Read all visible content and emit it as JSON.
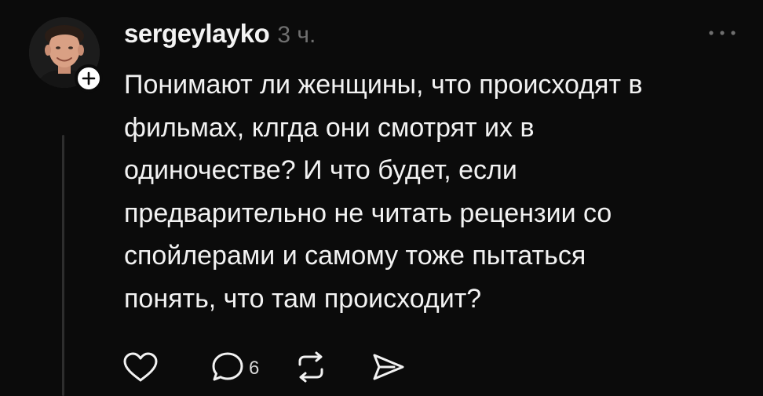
{
  "post": {
    "username": "sergeylayko",
    "timestamp": "3 ч.",
    "text": "Понимают ли женщины, что происходят в\nфильмах, клгда они смотрят их в\nодиночестве? И что будет, если\nпредварительно не читать рецензии со\nспойлерами и самому тоже пытаться\nпонять, что там происходит?",
    "reply_count": "6"
  },
  "icons": {
    "follow": "plus-icon",
    "more": "more-horizontal-icon",
    "like": "heart-icon",
    "reply": "comment-icon",
    "repost": "repost-icon",
    "share": "send-icon"
  },
  "colors": {
    "background": "#0b0b0b",
    "text": "#f2f2f2",
    "muted": "#6f6f6f",
    "thread_line": "#2e2e2e"
  }
}
